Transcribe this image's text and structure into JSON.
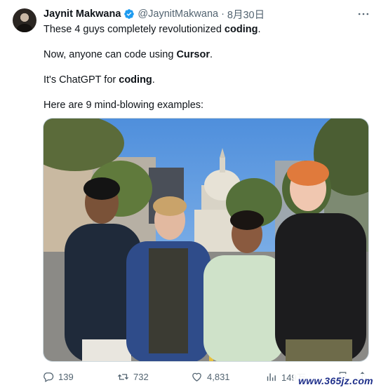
{
  "author": {
    "name": "Jaynit Makwana",
    "handle": "@JaynitMakwana",
    "separator": "·",
    "date": "8月30日"
  },
  "tweet": {
    "line1_pre": "These 4 guys completely revolutionized ",
    "line1_bold": "coding",
    "line1_post": ".",
    "line2_pre": "Now, anyone can code using ",
    "line2_bold": "Cursor",
    "line2_post": ".",
    "line3_pre": "It's ChatGPT for ",
    "line3_bold": "coding",
    "line3_post": ".",
    "line4": "Here are 9 mind-blowing examples:"
  },
  "actions": {
    "replies": "139",
    "reposts": "732",
    "likes": "4,831",
    "views": "149万"
  },
  "icons": {
    "verified": "verified-badge-icon",
    "more": "more-options-icon",
    "reply": "reply-icon",
    "repost": "repost-icon",
    "like": "heart-icon",
    "views": "views-chart-icon",
    "bookmark": "bookmark-icon",
    "share": "share-icon"
  },
  "colors": {
    "text": "#0f1419",
    "secondary": "#536471",
    "verified": "#1d9bf0",
    "sky": "#5f9be0",
    "watermark": "#1e2f8a"
  },
  "watermark": "www.365jz.com"
}
